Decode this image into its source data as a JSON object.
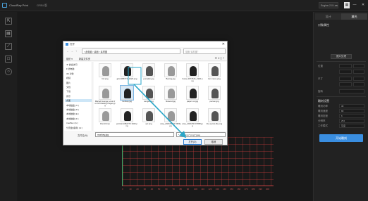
{
  "titlebar": {
    "app_title": "CloudRay Print",
    "menu": "GRBL版",
    "device": "Engine-2.0 Laser",
    "minimize": "—",
    "maximize": "□",
    "close": "✕"
  },
  "left_toolbar": {
    "tools": [
      "cursor-icon",
      "image-icon",
      "line-icon",
      "rectangle-icon",
      "circle-icon"
    ]
  },
  "right_panel": {
    "tabs": [
      "设计",
      "激光"
    ],
    "section_title": "对象属性",
    "btn_label": "图片处理",
    "pos_label": "位置",
    "size_label": "尺寸",
    "rotate_label": "旋转",
    "laser_section": "雕刻设置",
    "params": [
      {
        "label": "雕刻功率",
        "value": "30"
      },
      {
        "label": "雕刻速度",
        "value": "80"
      },
      {
        "label": "雕刻密度",
        "value": "6"
      },
      {
        "label": "分辨率",
        "value": "254"
      },
      {
        "label": "工作模式",
        "value": "灰度"
      }
    ],
    "start_button": "开始雕刻"
  },
  "dialog": {
    "title": "打开",
    "close": "✕",
    "address": "› 此电脑 › 桌面 › 素材图",
    "search_placeholder": "搜索\"素材图\"",
    "organize": "组织 ▾",
    "new_folder": "新建文件夹",
    "nav_items": [
      "★ 快速访问",
      "▾ 此电脑",
      "  3D 对象",
      "  视频",
      "  图片",
      "  文档",
      "  下载",
      "  音乐",
      "  桌面",
      "  本地磁盘 (C:)",
      "  本地磁盘 (D:)",
      "  本地磁盘 (E:)",
      "  本地磁盘 (F:)",
      "  truefflex (G:)",
      "  分页盘(备用) (H:)"
    ],
    "files": [
      {
        "name": "full.png"
      },
      {
        "name": "girl-4368774_1920.png"
      },
      {
        "name": "pumpkin.jpg"
      },
      {
        "name": "Boxing.jpg"
      },
      {
        "name": "horse-4077620_1920.png"
      },
      {
        "name": "lion mane.png"
      },
      {
        "name": "Marvel Avenge Lotus Iron M Drawing Pages.jpg"
      },
      {
        "name": "monkey.jpg"
      },
      {
        "name": "sengox.jpg"
      },
      {
        "name": "flowersl.jpg"
      },
      {
        "name": "paper cut.jpg"
      },
      {
        "name": "person.jpg"
      },
      {
        "name": "Pencil.bmp"
      },
      {
        "name": "portrait-1082270 1920.png"
      },
      {
        "name": "qcr.png"
      },
      {
        "name": "amp_202105051 5359.jpg"
      },
      {
        "name": "amp_2021050 15658.jpg"
      },
      {
        "name": "the-secret-life.png"
      }
    ],
    "filename_label": "文件名(N):",
    "filename_value": "monkey.jpg",
    "type_filter": "*.jpg;*.bmp;*.png;*.jpeg",
    "open_button": "打开(O)",
    "cancel_button": "取消"
  },
  "canvas": {
    "axis_ticks": [
      "0",
      "10",
      "20",
      "30",
      "40",
      "50",
      "60",
      "70",
      "80",
      "90",
      "100",
      "110",
      "120",
      "130",
      "140",
      "150",
      "160",
      "170",
      "180",
      "190",
      "200"
    ]
  }
}
